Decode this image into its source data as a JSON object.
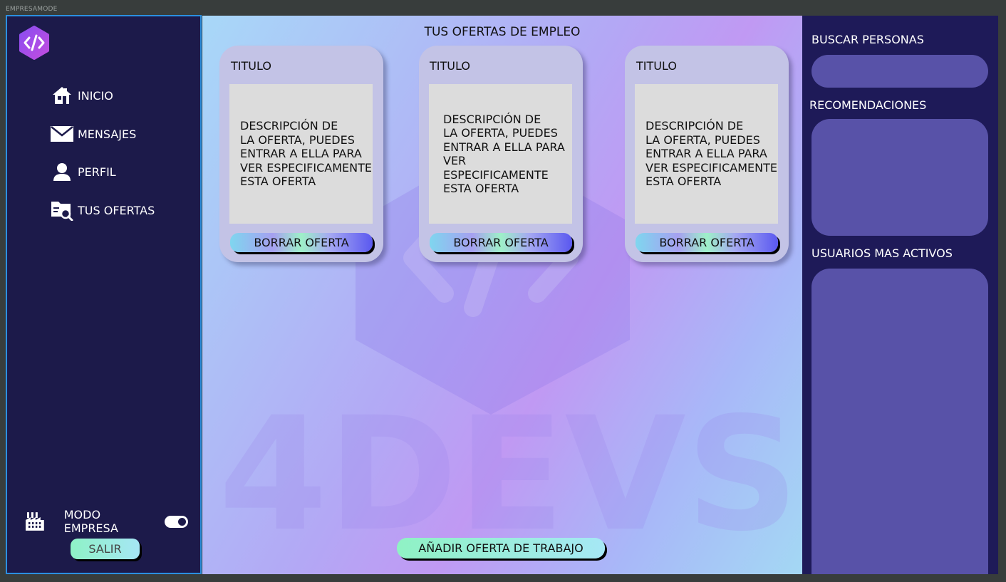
{
  "frame": {
    "label": "EMPRESAMODE"
  },
  "sidebar": {
    "logo_icon": "code-hexagon-logo",
    "items": [
      {
        "label": "INICIO",
        "icon": "home-icon"
      },
      {
        "label": "MENSAJES",
        "icon": "envelope-icon"
      },
      {
        "label": "PERFIL",
        "icon": "user-icon"
      },
      {
        "label": "TUS OFERTAS",
        "icon": "folder-search-icon"
      }
    ],
    "mode": {
      "label": "MODO EMPRESA",
      "icon": "factory-icon",
      "enabled": true
    },
    "exit_label": "SALIR"
  },
  "main": {
    "title": "TUS OFERTAS DE EMPLEO",
    "offers": [
      {
        "title": "TITULO",
        "description": "DESCRIPCIÓN DE\nLA OFERTA, PUEDES\nENTRAR A ELLA PARA\nVER ESPECIFICAMENTE\nESTA OFERTA",
        "button": "BORRAR OFERTA"
      },
      {
        "title": "TITULO",
        "description": "DESCRIPCIÓN DE\nLA OFERTA, PUEDES\nENTRAR A ELLA PARA\nVER ESPECIFICAMENTE\nESTA OFERTA",
        "button": "BORRAR OFERTA"
      },
      {
        "title": "TITULO",
        "description": "DESCRIPCIÓN DE\nLA OFERTA, PUEDES\nENTRAR A ELLA PARA\nVER ESPECIFICAMENTE\nESTA OFERTA",
        "button": "BORRAR OFERTA"
      }
    ],
    "watermark_text": "4DEVS",
    "add_button": "AÑADIR OFERTA DE TRABAJO"
  },
  "right": {
    "search_label": "BUSCAR PERSONAS",
    "recommendations_label": "RECOMENDACIONES",
    "active_users_label": "USUARIOS MAS ACTIVOS"
  },
  "colors": {
    "sidebar_bg": "#1c1a4a",
    "sidebar_border": "#2b8fe0",
    "right_bg": "#1e1a58",
    "panel_box": "#5852a8",
    "card_bg": "#c3c3e6",
    "card_desc_bg": "#dcdcdc"
  }
}
